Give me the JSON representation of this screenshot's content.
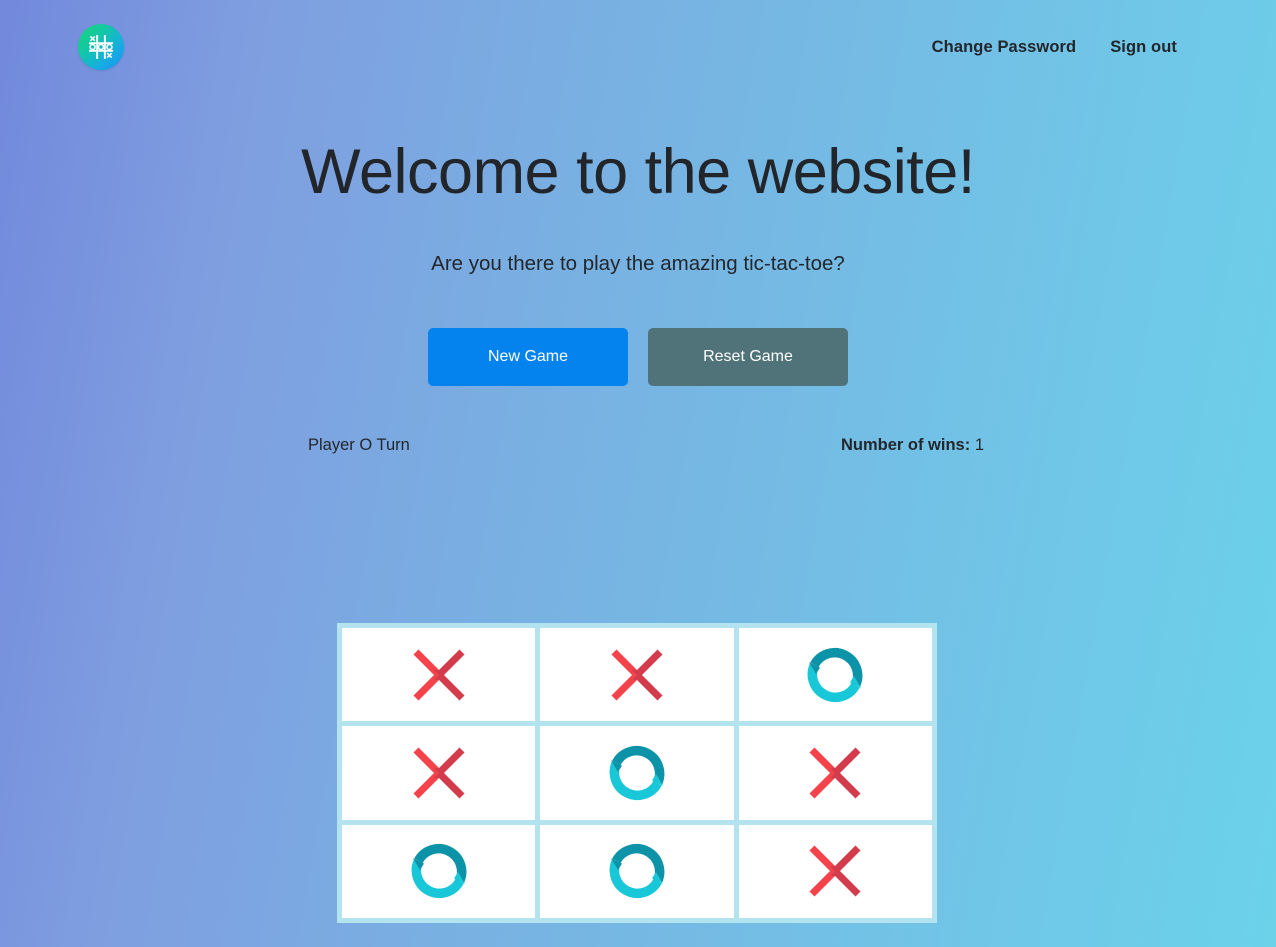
{
  "header": {
    "logo_icon": "tic-tac-toe-logo-icon",
    "links": [
      {
        "label": "Change Password",
        "name": "change-password-link"
      },
      {
        "label": "Sign out",
        "name": "sign-out-link"
      }
    ]
  },
  "hero": {
    "title": "Welcome to the website!",
    "subtitle": "Are you there to play the amazing tic-tac-toe?"
  },
  "actions": {
    "new_game_label": "New Game",
    "reset_game_label": "Reset Game",
    "new_game_color": "#0483ee",
    "reset_game_color": "#4f7378"
  },
  "status": {
    "turn_text": "Player O Turn",
    "wins_label": "Number of wins:",
    "wins_value": "1"
  },
  "board": {
    "x_icon": "x-mark-icon",
    "o_icon": "o-mark-icon",
    "x_color_light": "#f4434a",
    "x_color_dark": "#d33c4c",
    "o_color_light": "#18c8d8",
    "o_color_dark": "#0d93a8",
    "cell_background": "#ffffff",
    "grid_background": "#b3e3ef",
    "cells": [
      {
        "index": 0,
        "value": "X"
      },
      {
        "index": 1,
        "value": "X"
      },
      {
        "index": 2,
        "value": "O"
      },
      {
        "index": 3,
        "value": "X"
      },
      {
        "index": 4,
        "value": "O"
      },
      {
        "index": 5,
        "value": "X"
      },
      {
        "index": 6,
        "value": "O"
      },
      {
        "index": 7,
        "value": "O"
      },
      {
        "index": 8,
        "value": "X"
      }
    ]
  },
  "theme": {
    "background_left": "#7289dc",
    "background_right": "#6bd2ea",
    "text_color": "#23272c"
  }
}
